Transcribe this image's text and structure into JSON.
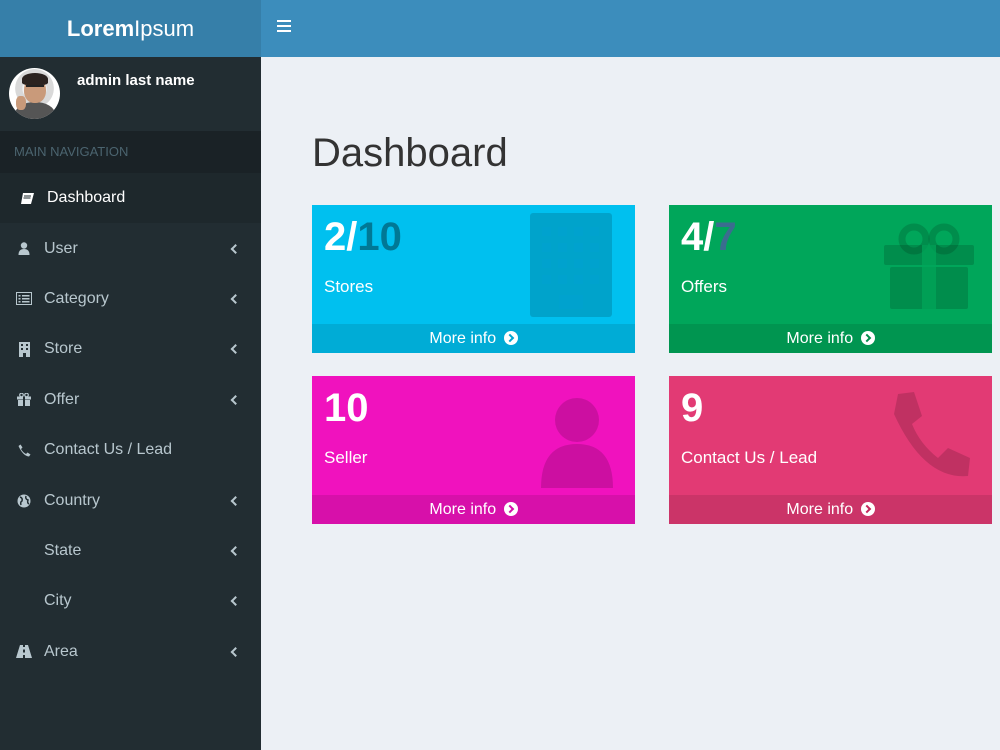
{
  "brand": {
    "bold": "Lorem",
    "light": "Ipsum"
  },
  "user": {
    "name": "admin last name"
  },
  "nav": {
    "header": "MAIN NAVIGATION",
    "items": [
      {
        "label": "Dashboard",
        "icon": "book-icon",
        "active": true,
        "chevron": false
      },
      {
        "label": "User",
        "icon": "user-icon",
        "chevron": true
      },
      {
        "label": "Category",
        "icon": "list-icon",
        "chevron": true
      },
      {
        "label": "Store",
        "icon": "building-icon",
        "chevron": true
      },
      {
        "label": "Offer",
        "icon": "gift-icon",
        "chevron": true
      },
      {
        "label": "Contact Us / Lead",
        "icon": "phone-icon",
        "chevron": false
      },
      {
        "label": "Country",
        "icon": "globe-icon",
        "chevron": true
      },
      {
        "label": "State",
        "icon": "",
        "chevron": true
      },
      {
        "label": "City",
        "icon": "",
        "chevron": true
      },
      {
        "label": "Area",
        "icon": "road-icon",
        "chevron": true
      }
    ]
  },
  "page": {
    "title": "Dashboard"
  },
  "boxes": [
    {
      "count": "2/",
      "count_dim": "10",
      "label": "Stores",
      "more": "More info",
      "color": "#00c0ef",
      "icon": "building-icon"
    },
    {
      "count": "4/",
      "count_dim": "7",
      "label": "Offers",
      "more": "More info",
      "color": "#00a65a",
      "icon": "gift-icon"
    },
    {
      "count": "10",
      "count_dim": "",
      "label": "Seller",
      "more": "More info",
      "color": "#f012be",
      "icon": "user-icon"
    },
    {
      "count": "9",
      "count_dim": "",
      "label": "Contact Us / Lead",
      "more": "More info",
      "color": "#e23a74",
      "icon": "phone-icon"
    }
  ]
}
